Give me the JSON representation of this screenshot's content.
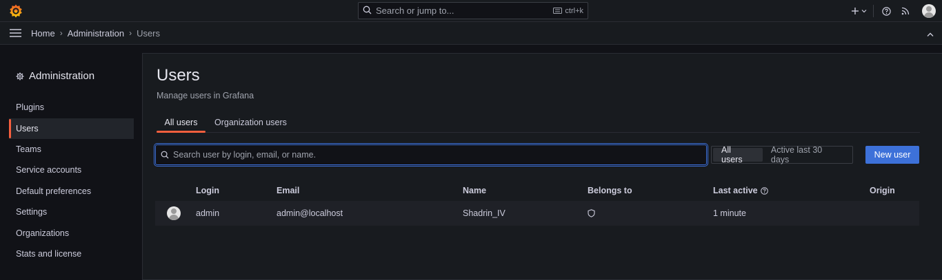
{
  "topbar": {
    "search_placeholder": "Search or jump to...",
    "shortcut": "ctrl+k",
    "icons": [
      "grafana-logo-icon",
      "search-icon",
      "keyboard-icon",
      "plus-icon",
      "chevron-down-icon",
      "help-icon",
      "rss-icon",
      "user-avatar"
    ]
  },
  "breadcrumbs": [
    {
      "label": "Home"
    },
    {
      "label": "Administration"
    },
    {
      "label": "Users"
    }
  ],
  "sidebar": {
    "title": "Administration",
    "items": [
      {
        "label": "Plugins",
        "active": false
      },
      {
        "label": "Users",
        "active": true
      },
      {
        "label": "Teams",
        "active": false
      },
      {
        "label": "Service accounts",
        "active": false
      },
      {
        "label": "Default preferences",
        "active": false
      },
      {
        "label": "Settings",
        "active": false
      },
      {
        "label": "Organizations",
        "active": false
      },
      {
        "label": "Stats and license",
        "active": false
      }
    ]
  },
  "page": {
    "title": "Users",
    "subtitle": "Manage users in Grafana",
    "tabs": [
      {
        "label": "All users",
        "active": true
      },
      {
        "label": "Organization users",
        "active": false
      }
    ],
    "search_placeholder": "Search user by login, email, or name.",
    "filter": {
      "options": [
        "All users",
        "Active last 30 days"
      ],
      "selected": "All users"
    },
    "new_user_label": "New user"
  },
  "table": {
    "columns": [
      "Login",
      "Email",
      "Name",
      "Belongs to",
      "Last active",
      "Origin"
    ],
    "rows": [
      {
        "login": "admin",
        "email": "admin@localhost",
        "name": "Shadrin_IV",
        "belongs_to_icon": "shield-icon",
        "last_active": "1 minute",
        "origin": ""
      }
    ]
  },
  "colors": {
    "accent_orange": "#f55f3e",
    "primary_blue": "#3d71d9",
    "background": "#111217",
    "panel": "#181b1f"
  }
}
